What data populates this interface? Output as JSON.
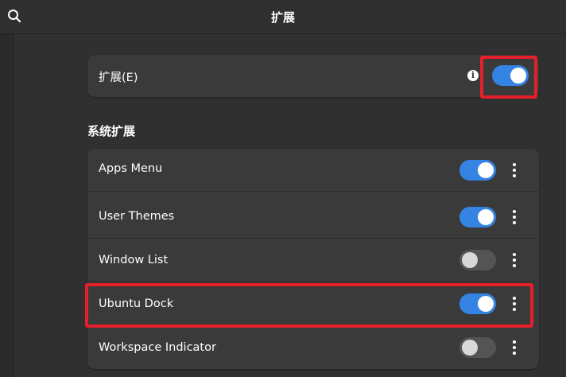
{
  "header": {
    "title": "扩展",
    "search_icon": "search-icon"
  },
  "main_toggle": {
    "label": "扩展(E)",
    "info_icon": "info-icon",
    "enabled": true
  },
  "section": {
    "title": "系统扩展"
  },
  "extensions": [
    {
      "name": "Apps Menu",
      "enabled": true
    },
    {
      "name": "User Themes",
      "enabled": true
    },
    {
      "name": "Window List",
      "enabled": false
    },
    {
      "name": "Ubuntu Dock",
      "enabled": true
    },
    {
      "name": "Workspace Indicator",
      "enabled": false
    }
  ],
  "colors": {
    "accent": "#3584e4",
    "highlight": "#e4202b",
    "background": "#303030",
    "card": "#3a3a3a"
  }
}
